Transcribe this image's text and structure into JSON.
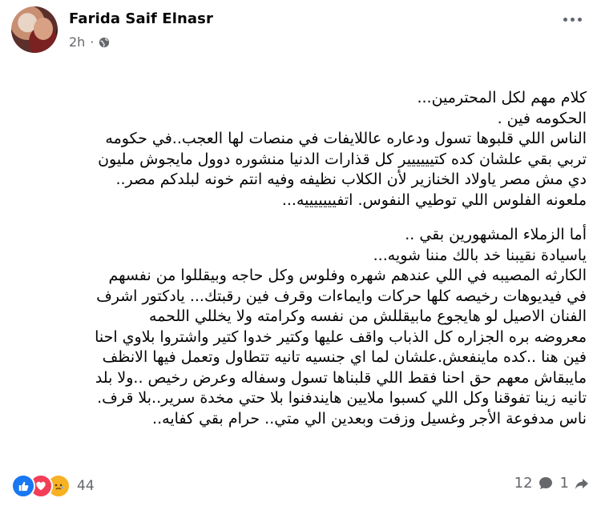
{
  "post": {
    "author": "Farida Saif Elnasr",
    "time": "2h",
    "lines": [
      "كلام مهم لكل المحترمين...",
      "الحكومه فين .",
      "الناس اللي قلبوها تسول ودعاره عاللايفات في منصات لها العجب..في حكومه",
      "تربي بقي علشان كده كتيييييير كل قذارات الدنيا منشوره دوول مايجوش  مليون",
      "دي مش مصر ياولاد الخنازير لأن الكلاب نظيفه وفيه انتم خونه لبلدكم مصر..",
      "ملعونه الفلوس اللي توطيي النفوس. اتفيييييييه..."
    ],
    "lines2": [
      "أما الزملاء المشهورين بقي ..",
      "ياسيادة نقيبنا خد بالك مننا شويه...",
      "الكارثه المصيبه في اللي عندهم شهره وفلوس وكل حاجه وبيقللوا من نفسهم",
      "في فيديوهات رخيصه كلها حركات وايماءات وقرف فين رقبتك... يادكتور اشرف",
      "الفنان الاصيل لو هايجوع مابيقللش من نفسه وكرامته ولا يخللي اللحمه",
      "معروضه بره الجزاره كل الذباب واقف عليها وكتير خدوا كتير واشتروا بلاوي احنا",
      "فين هنا ..كده ماينفعش.علشان لما اي جنسيه تانيه تتطاول وتعمل فيها الانظف",
      "مايبقاش معهم حق احنا فقط اللي قلبناها تسول وسفاله وعرض رخيص ..ولا بلد",
      "تانيه زينا تفوقنا وكل اللي كسبوا ملايين هايندفنوا بلا حتي مخدة سرير..بلا قرف.",
      "ناس مدفوعة الأجر وغسيل وزفت وبعدين الي متي.. حرام بقي كفايه.."
    ]
  },
  "footer": {
    "reactions_count": "44",
    "comments_count": "12",
    "shares_count": "1"
  },
  "icons": {
    "like": "like-reaction-icon",
    "love": "love-reaction-icon",
    "sad": "sad-reaction-icon"
  }
}
